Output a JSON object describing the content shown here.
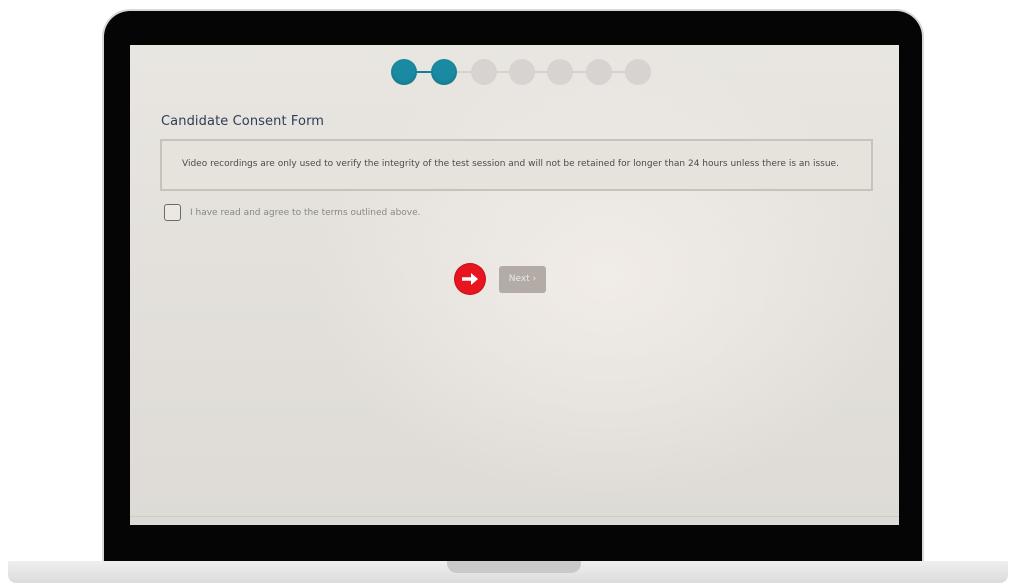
{
  "stepper": {
    "total_steps": 7,
    "active_steps": 2
  },
  "form": {
    "title": "Candidate Consent Form",
    "notice": "Video recordings are only used to verify the integrity of the test session and will not be retained for longer than 24 hours unless there is an issue.",
    "consent_label": "I have read and agree to the terms outlined above.",
    "consent_checked": false
  },
  "actions": {
    "next_label": "Next",
    "next_chevron": "›"
  },
  "annotation": {
    "icon": "arrow-right-icon",
    "color": "#e8141f"
  },
  "colors": {
    "accent": "#1a8aa2",
    "step_inactive": "#d6d3d0",
    "button": "#b3aba5"
  }
}
